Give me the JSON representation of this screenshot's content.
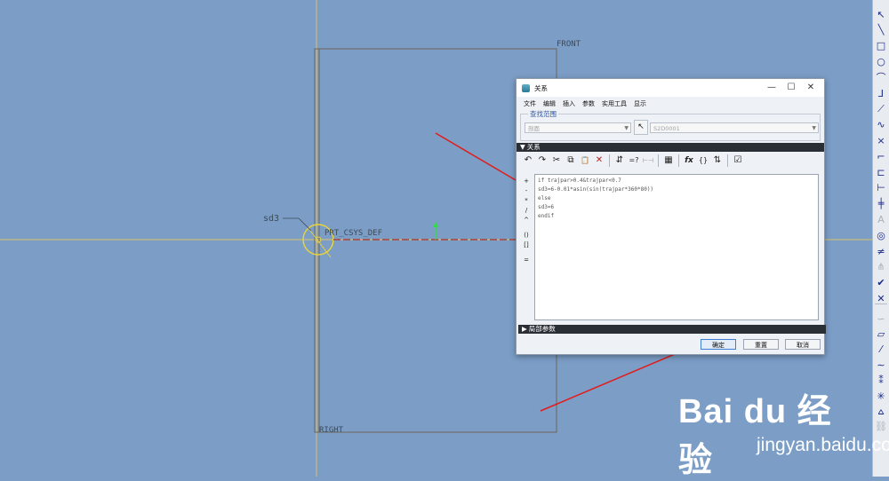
{
  "canvas": {
    "labels": {
      "front": "FRONT",
      "right": "RIGHT",
      "csys": "PRT_CSYS_DEF",
      "dim": "sd3"
    }
  },
  "right_toolbar": {
    "icons": [
      {
        "icon": "pointer-icon",
        "glyph": "↖",
        "enabled": true
      },
      {
        "icon": "line-icon",
        "glyph": "╲",
        "enabled": true
      },
      {
        "icon": "rectangle-icon",
        "glyph": "□",
        "enabled": true
      },
      {
        "icon": "circle-icon",
        "glyph": "○",
        "enabled": true
      },
      {
        "icon": "arc-icon",
        "glyph": "⌒",
        "enabled": true
      },
      {
        "icon": "fillet-icon",
        "glyph": "⅃",
        "enabled": true
      },
      {
        "icon": "chamfer-icon",
        "glyph": "⟋",
        "enabled": true
      },
      {
        "icon": "spline-icon",
        "glyph": "∿",
        "enabled": true
      },
      {
        "icon": "point-icon",
        "glyph": "×",
        "enabled": true
      },
      {
        "icon": "coordinate-system-icon",
        "glyph": "⌐",
        "enabled": true
      },
      {
        "icon": "offset-icon",
        "glyph": "⊏",
        "enabled": true
      },
      {
        "icon": "dimension-icon",
        "glyph": "⊢",
        "enabled": true
      },
      {
        "icon": "constraint-icon",
        "glyph": "╪",
        "enabled": true
      },
      {
        "icon": "text-icon",
        "glyph": "A",
        "enabled": false
      },
      {
        "icon": "palette-icon",
        "glyph": "◎",
        "enabled": true
      },
      {
        "icon": "trim-icon",
        "glyph": "≠",
        "enabled": true
      },
      {
        "icon": "mirror-icon",
        "glyph": "⋔",
        "enabled": false
      },
      {
        "icon": "ok-icon",
        "glyph": "✔",
        "enabled": true
      },
      {
        "icon": "cancel-icon",
        "glyph": "✕",
        "enabled": true
      },
      {
        "icon": "datum-curve-icon",
        "glyph": "∽",
        "enabled": false
      },
      {
        "icon": "datum-plane-icon",
        "glyph": "▱",
        "enabled": true
      },
      {
        "icon": "datum-axis-icon",
        "glyph": "⁄",
        "enabled": true
      },
      {
        "icon": "datum-sketch-icon",
        "glyph": "∼",
        "enabled": true
      },
      {
        "icon": "datum-point-icon",
        "glyph": "⁑",
        "enabled": true
      },
      {
        "icon": "datum-csys-icon",
        "glyph": "✳",
        "enabled": true
      },
      {
        "icon": "analysis-icon",
        "glyph": "⩟",
        "enabled": true
      },
      {
        "icon": "chain-icon",
        "glyph": "⛓",
        "enabled": false
      }
    ]
  },
  "dialog": {
    "title": "关系",
    "menu": [
      "文件",
      "编辑",
      "插入",
      "参数",
      "实用工具",
      "显示"
    ],
    "search_scope": {
      "label": "查找范围",
      "type_value": "剖面",
      "item_value": "S2D0001"
    },
    "relations_header": "关系",
    "toolbar": [
      {
        "icon": "undo-icon",
        "glyph": "↶"
      },
      {
        "icon": "redo-icon",
        "glyph": "↷"
      },
      {
        "icon": "cut-icon",
        "glyph": "✂"
      },
      {
        "icon": "copy-icon",
        "glyph": "⧉"
      },
      {
        "icon": "paste-icon",
        "glyph": "📋"
      },
      {
        "icon": "delete-icon",
        "glyph": "✕"
      },
      {
        "icon": "switch-dims-icon",
        "glyph": "⇵"
      },
      {
        "icon": "evaluate-icon",
        "glyph": "=?"
      },
      {
        "icon": "measure-icon",
        "glyph": "⊢⊣"
      },
      {
        "icon": "param-icon",
        "glyph": "▦"
      },
      {
        "icon": "function-icon",
        "glyph": "fx"
      },
      {
        "icon": "braces-icon",
        "glyph": "{}"
      },
      {
        "icon": "sort-icon",
        "glyph": "⇅"
      },
      {
        "icon": "check-icon",
        "glyph": "☑"
      }
    ],
    "operators": [
      "+",
      "-",
      "*",
      "/",
      "^",
      "()",
      "[]",
      "="
    ],
    "relations_text": "if trajpar>0.4&trajpar<0.7\nsd3=6-0.01*asin(sin(trajpar*360*80))\nelse\nsd3=6\nendif",
    "local_params_header": "局部参数",
    "buttons": {
      "ok": "确定",
      "reset": "重置",
      "cancel": "取消"
    },
    "window_controls": {
      "minimize": "—",
      "maximize": "☐",
      "close": "✕"
    }
  },
  "watermark": {
    "brand": "Bai du 经验",
    "url": "jingyan.baidu.com"
  }
}
